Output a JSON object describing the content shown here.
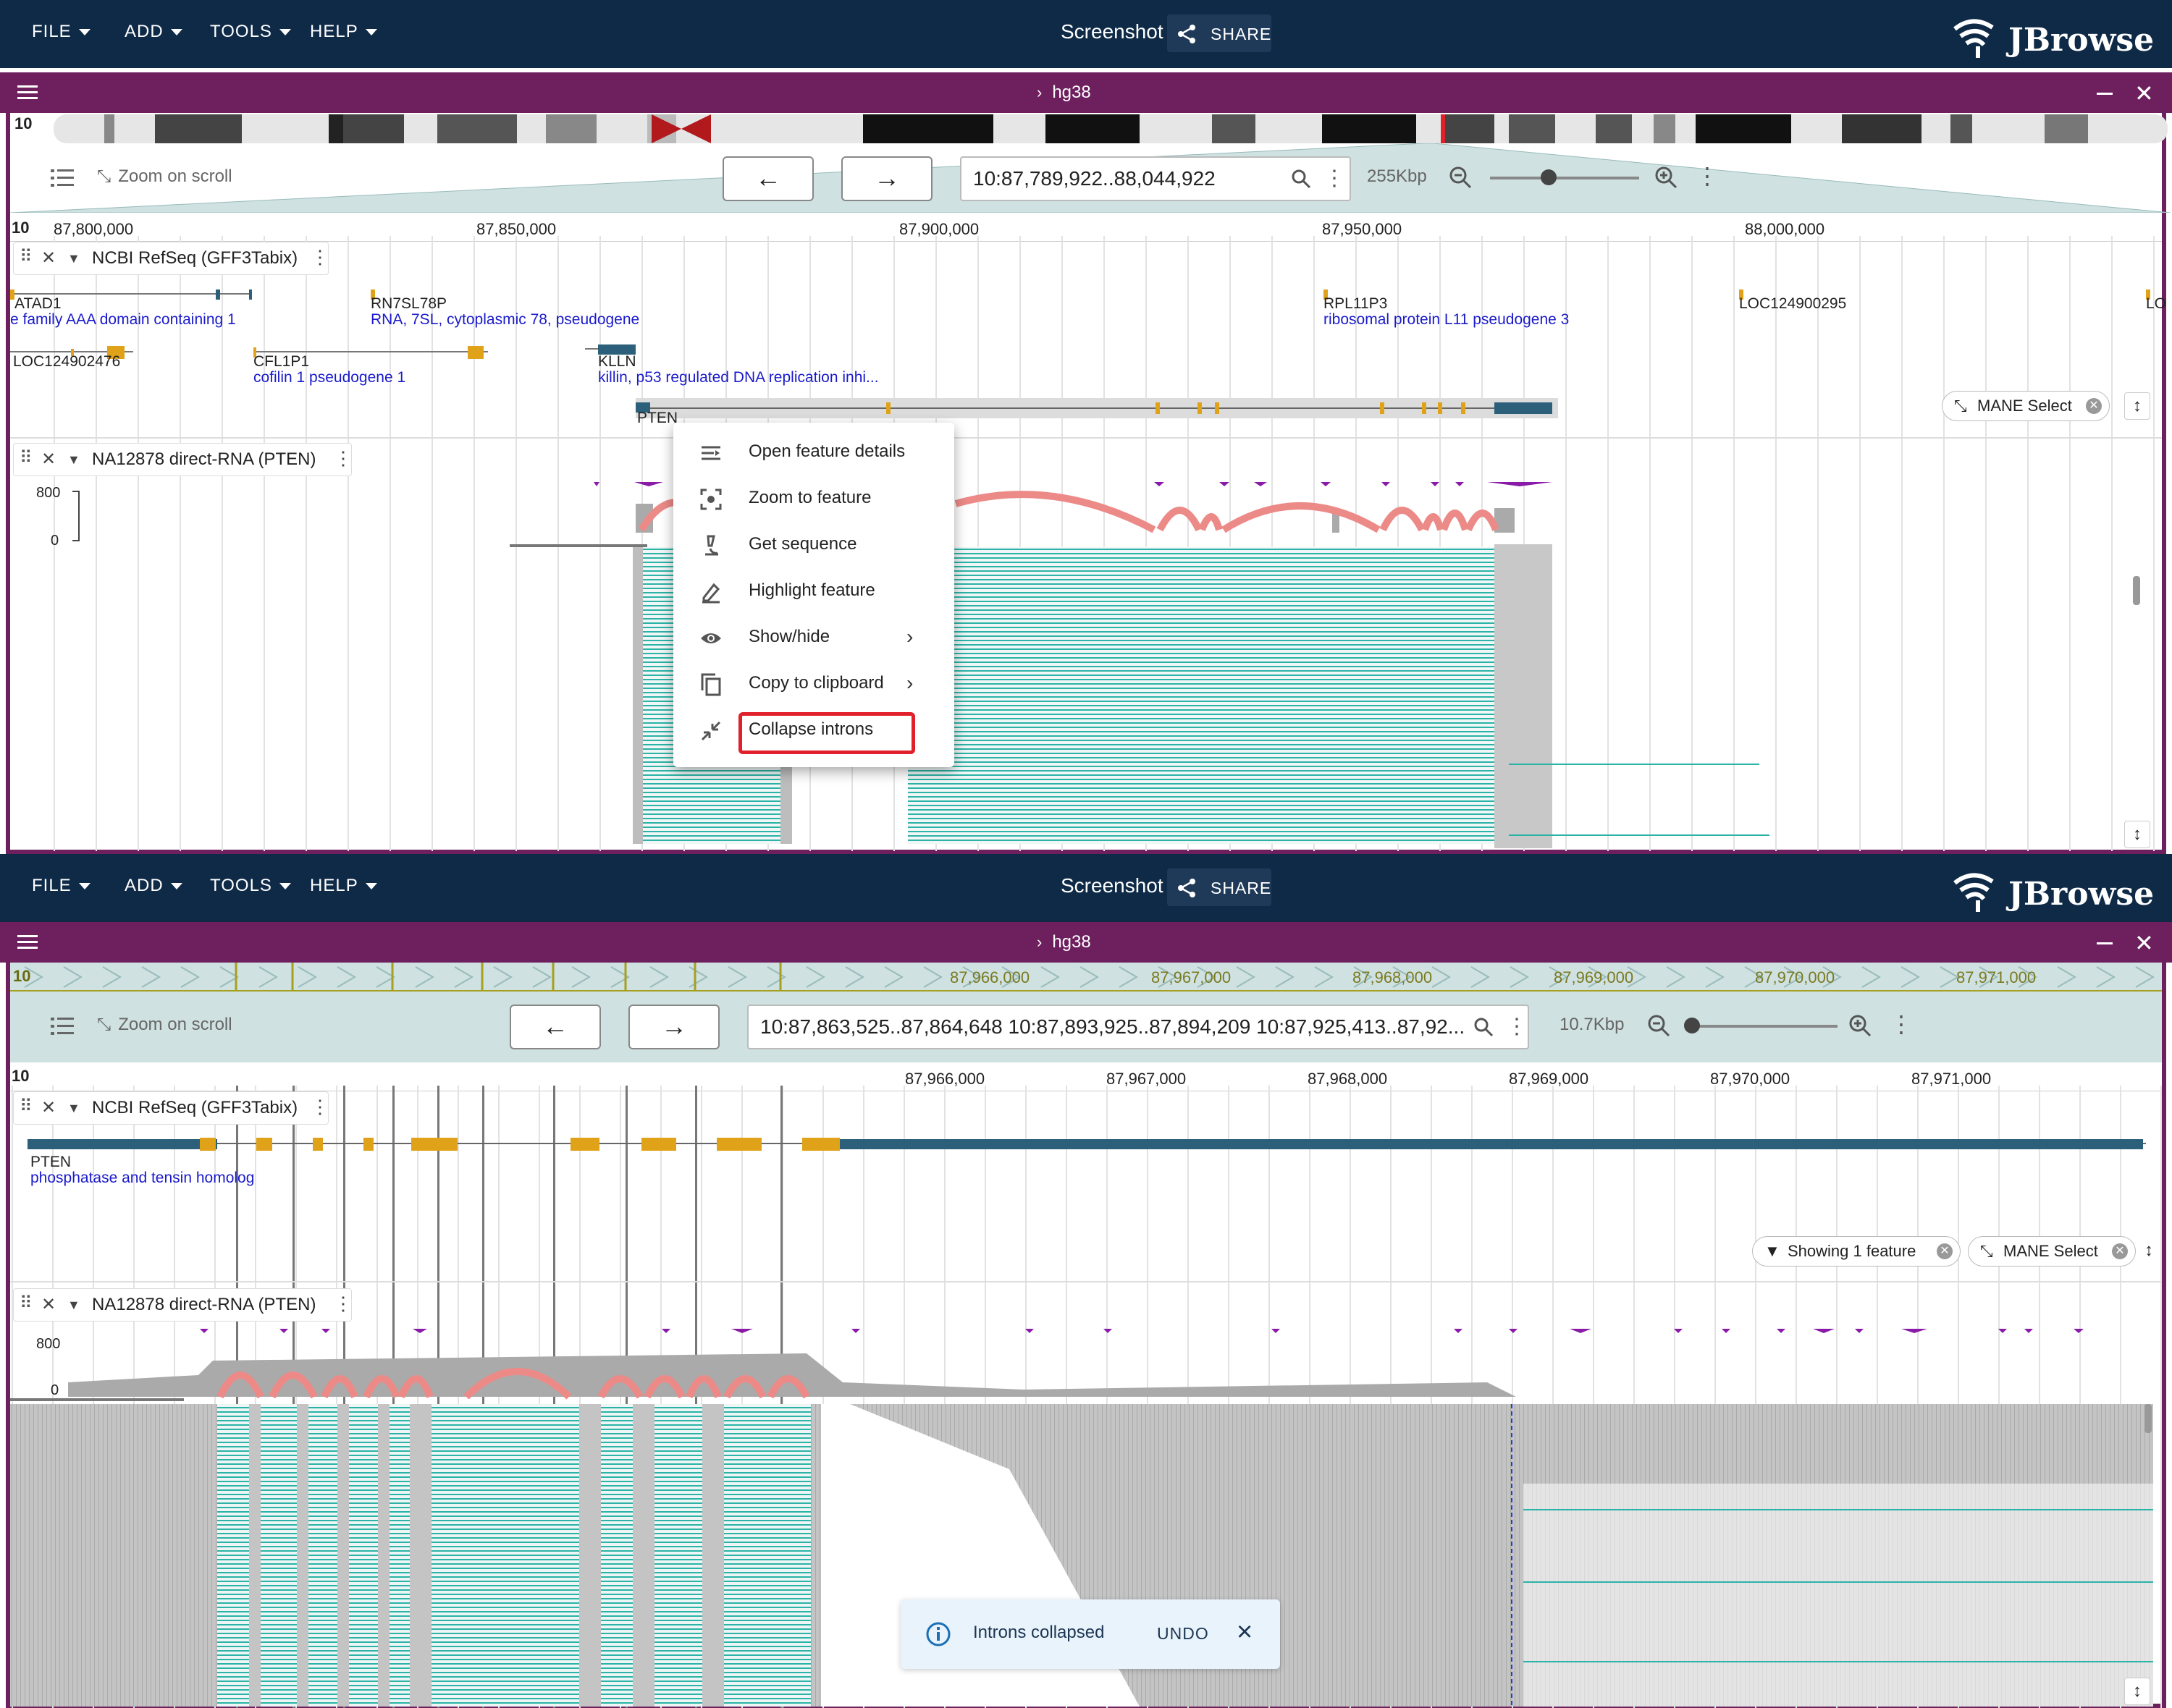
{
  "app": {
    "menus": [
      "FILE",
      "ADD",
      "TOOLS",
      "HELP"
    ],
    "title": "Screenshot",
    "share": "SHARE",
    "logo": "JBrowse",
    "assembly": "hg38"
  },
  "panel1": {
    "chrom": "10",
    "zoom_on_scroll": "Zoom on scroll",
    "locstring": "10:87,789,922..88,044,922",
    "span": "255Kbp",
    "ruler_ticks": [
      "87,800,000",
      "87,850,000",
      "87,900,000",
      "87,950,000",
      "88,000,000"
    ],
    "track1": {
      "title": "NCBI RefSeq (GFF3Tabix)",
      "genes": [
        {
          "name": "ATAD1",
          "desc": "e family AAA domain containing 1"
        },
        {
          "name": "RN7SL78P",
          "desc": "RNA, 7SL, cytoplasmic 78, pseudogene"
        },
        {
          "name": "RPL11P3",
          "desc": "ribosomal protein L11 pseudogene 3"
        },
        {
          "name": "LOC124900295",
          "desc": ""
        },
        {
          "name": "LO",
          "desc": ""
        },
        {
          "name": "LOC124902476",
          "desc": ""
        },
        {
          "name": "CFL1P1",
          "desc": "cofilin 1 pseudogene 1"
        },
        {
          "name": "KLLN",
          "desc": "killin, p53 regulated DNA replication inhi..."
        },
        {
          "name": "PTEN",
          "desc": ""
        }
      ],
      "chip": "MANE Select"
    },
    "track2": {
      "title": "NA12878 direct-RNA (PTEN)",
      "scale_max": "800",
      "scale_min": "0"
    },
    "context_menu": [
      {
        "label": "Open feature details",
        "icon": "list-icon",
        "submenu": false
      },
      {
        "label": "Zoom to feature",
        "icon": "center-focus-icon",
        "submenu": false
      },
      {
        "label": "Get sequence",
        "icon": "microscope-icon",
        "submenu": false
      },
      {
        "label": "Highlight feature",
        "icon": "highlighter-icon",
        "submenu": false
      },
      {
        "label": "Show/hide",
        "icon": "eye-icon",
        "submenu": true
      },
      {
        "label": "Copy to clipboard",
        "icon": "copy-icon",
        "submenu": true
      },
      {
        "label": "Collapse introns",
        "icon": "collapse-icon",
        "submenu": false
      }
    ]
  },
  "panel2": {
    "chrom": "10",
    "zoom_on_scroll": "Zoom on scroll",
    "locstring": "10:87,863,525..87,864,648 10:87,893,925..87,894,209 10:87,925,413..87,92...",
    "span": "10.7Kbp",
    "overview_ticks": [
      "87,966,000",
      "87,967,000",
      "87,968,000",
      "87,969,000",
      "87,970,000",
      "87,971,000"
    ],
    "ruler_ticks": [
      "87,966,000",
      "87,967,000",
      "87,968,000",
      "87,969,000",
      "87,970,000",
      "87,971,000"
    ],
    "track1": {
      "title": "NCBI RefSeq (GFF3Tabix)",
      "gene": "PTEN",
      "desc": "phosphatase and tensin homolog",
      "chip_filter": "Showing 1 feature",
      "chip_mane": "MANE Select"
    },
    "track2": {
      "title": "NA12878 direct-RNA (PTEN)",
      "scale_max": "800",
      "scale_min": "0"
    },
    "snackbar": {
      "message": "Introns collapsed",
      "action": "UNDO"
    }
  },
  "colors": {
    "appbar": "#0e2a47",
    "view_header": "#6d1f5e",
    "utr": "#2b5f7a",
    "cds": "#e0a218",
    "sashimi": "#ec8a88",
    "reads_teal": "#2ab3a6",
    "highlight": "#e0202a"
  }
}
